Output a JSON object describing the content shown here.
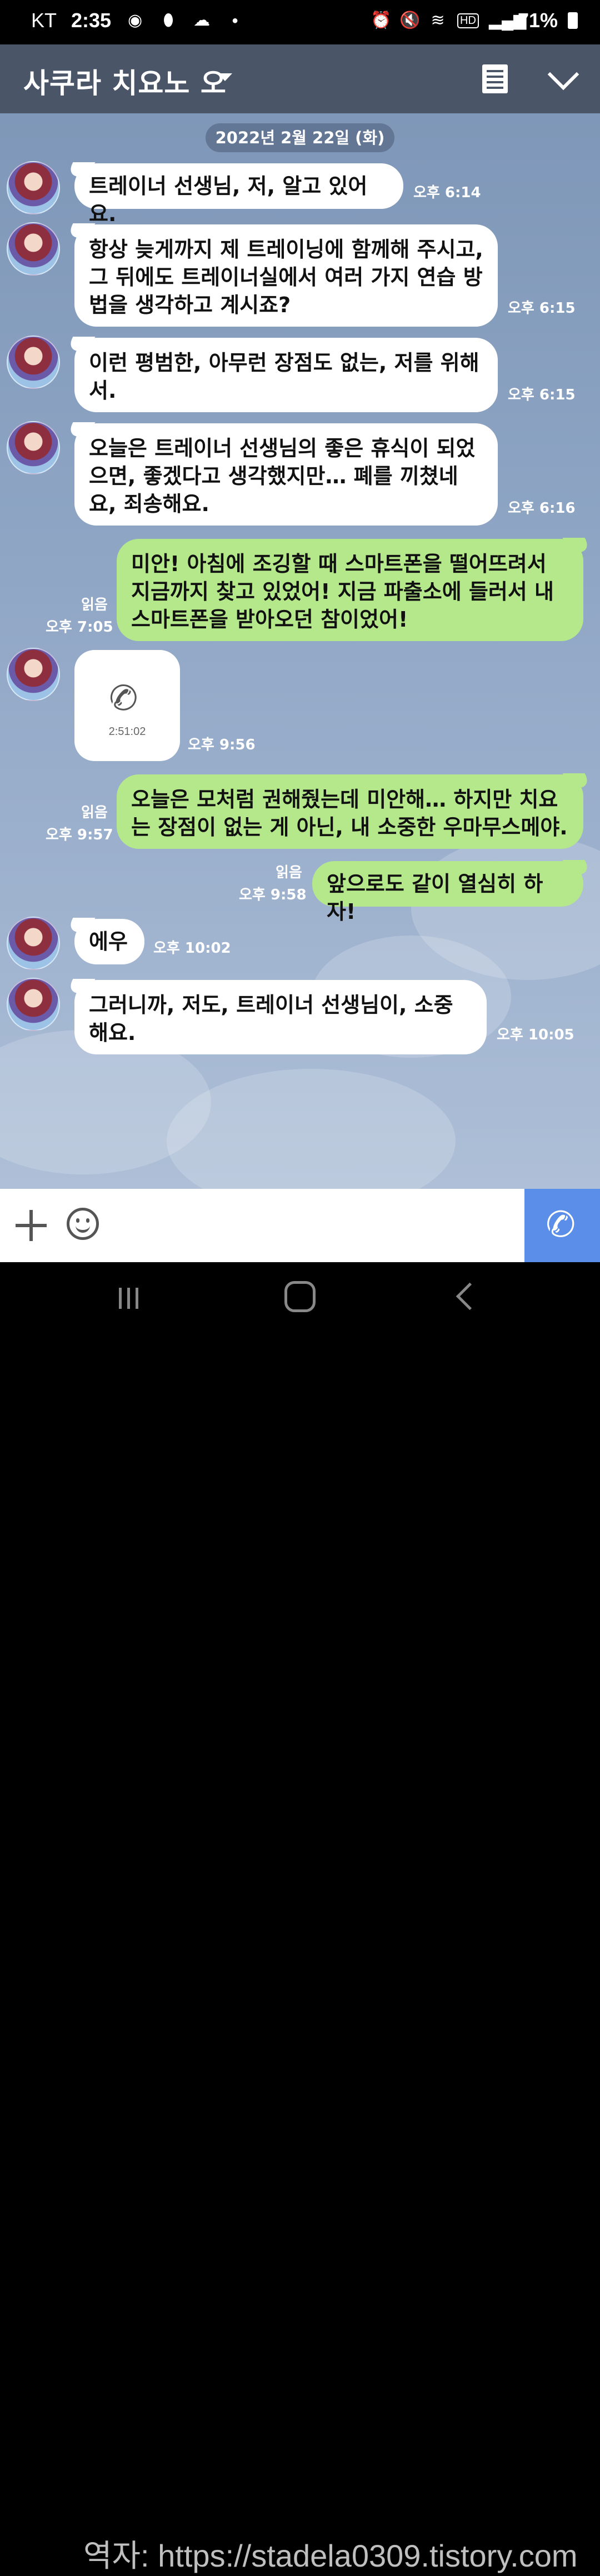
{
  "status_bar": {
    "carrier": "KT",
    "time": "2:35",
    "hd_label": "HD",
    "battery": "71%"
  },
  "header": {
    "title": "사쿠라 치요노 오"
  },
  "chat": {
    "date_divider": "2022년 2월 22일 (화)",
    "messages": [
      {
        "text": "트레이너 선생님, 저, 알고 있어요.",
        "time": "오후 6:14"
      },
      {
        "text": "항상 늦게까지 제 트레이닝에 함께해 주시고, 그 뒤에도 트레이너실에서 여러 가지 연습 방법을 생각하고 계시죠?",
        "time": "오후 6:15"
      },
      {
        "text": "이런 평범한, 아무런 장점도 없는, 저를 위해서.",
        "time": "오후 6:15"
      },
      {
        "text": "오늘은 트레이너 선생님의 좋은 휴식이 되었으면, 좋겠다고 생각했지만… 폐를 끼쳤네요, 죄송해요.",
        "time": "오후 6:16"
      },
      {
        "text": "미안! 아침에 조깅할 때 스마트폰을 떨어뜨려서 지금까지 찾고 있었어! 지금 파출소에 들러서 내 스마트폰을 받아오던 참이었어!",
        "time": "오후 7:05",
        "read": "읽음"
      },
      {
        "call_duration": "2:51:02",
        "time": "오후 9:56"
      },
      {
        "text": "오늘은 모처럼 권해줬는데 미안해… 하지만 치요는 장점이 없는 게 아닌, 내 소중한 우마무스메야.",
        "time": "오후 9:57",
        "read": "읽음"
      },
      {
        "text": "앞으로도 같이 열심히 하자!",
        "time": "오후 9:58",
        "read": "읽음"
      },
      {
        "text": "에우",
        "time": "오후 10:02"
      },
      {
        "text": "그러니까, 저도, 트레이너 선생님이, 소중해요.",
        "time": "오후 10:05"
      }
    ]
  },
  "watermark": "역자: https://stadela0309.tistory.com",
  "colors": {
    "header_bg": "#4a5568",
    "chat_bg": "#8ea5c4",
    "incoming_bubble": "#ffffff",
    "outgoing_bubble": "#b4e88a",
    "call_button": "#5a8ee8"
  },
  "icons": [
    "camera-icon",
    "link-icon",
    "cloud-icon",
    "alarm-icon",
    "mute-icon",
    "wifi-icon",
    "signal-icon",
    "battery-icon",
    "notes-icon",
    "chevron-down-icon",
    "phone-icon",
    "plus-icon",
    "emoji-icon",
    "call-icon",
    "recent-apps-icon",
    "home-icon",
    "back-icon"
  ]
}
